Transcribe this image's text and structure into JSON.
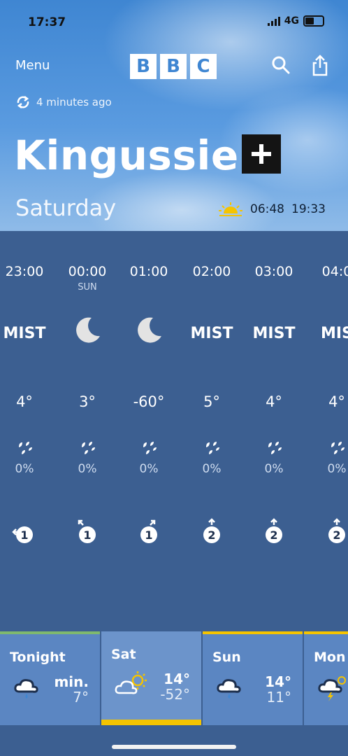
{
  "status_bar": {
    "time": "17:37",
    "network": "4G"
  },
  "nav": {
    "menu_label": "Menu",
    "logo_letters": [
      "B",
      "B",
      "C"
    ]
  },
  "updated": "4 minutes ago",
  "location": "Kingussie",
  "day": "Saturday",
  "sunrise": "06:48",
  "sunset": "19:33",
  "hourly": [
    {
      "time": "23:00",
      "sub": "",
      "condition": "MIST",
      "icon": "",
      "temp": "4°",
      "rain": "0%",
      "wind": "1",
      "wind_dir": "west-arrow-icon"
    },
    {
      "time": "00:00",
      "sub": "SUN",
      "condition": "",
      "icon": "moon-icon",
      "temp": "3°",
      "rain": "0%",
      "wind": "1",
      "wind_dir": "north-west-arrow-icon"
    },
    {
      "time": "01:00",
      "sub": "",
      "condition": "",
      "icon": "moon-icon",
      "temp": "-60°",
      "rain": "0%",
      "wind": "1",
      "wind_dir": "north-east-arrow-icon"
    },
    {
      "time": "02:00",
      "sub": "",
      "condition": "MIST",
      "icon": "",
      "temp": "5°",
      "rain": "0%",
      "wind": "2",
      "wind_dir": "north-arrow-icon"
    },
    {
      "time": "03:00",
      "sub": "",
      "condition": "MIST",
      "icon": "",
      "temp": "4°",
      "rain": "0%",
      "wind": "2",
      "wind_dir": "north-arrow-icon"
    },
    {
      "time": "04:0",
      "sub": "",
      "condition": "MIS",
      "icon": "",
      "temp": "4°",
      "rain": "0%",
      "wind": "2",
      "wind_dir": "north-arrow-icon"
    }
  ],
  "daily": [
    {
      "name": "Tonight",
      "high": "min.",
      "low": "7°",
      "icon": "rain-cloud-icon"
    },
    {
      "name": "Sat",
      "high": "14°",
      "low": "-52°",
      "icon": "sun-cloud-icon"
    },
    {
      "name": "Sun",
      "high": "14°",
      "low": "11°",
      "icon": "rain-cloud-icon"
    },
    {
      "name": "Mon",
      "high": "",
      "low": "",
      "icon": "thunder-cloud-icon"
    }
  ],
  "colors": {
    "sky": "#3f86d2",
    "panel": "#3c5f91",
    "accent": "#f5c400",
    "card": "#5b86c2"
  }
}
